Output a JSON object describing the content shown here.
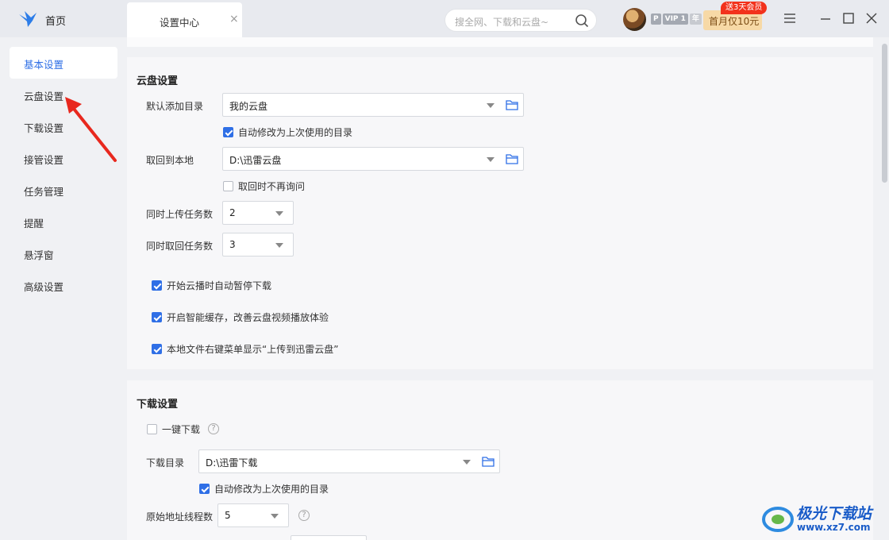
{
  "titlebar": {
    "home_label": "首页",
    "tab_label": "设置中心",
    "tab_close": "×",
    "search_placeholder": "搜全网、下载和云盘~",
    "badge_p": "P",
    "badge_vip": "VIP 1",
    "badge_year": "年",
    "promo_label": "首月仅10元",
    "promo_tag": "送3天会员"
  },
  "sidebar": {
    "items": [
      {
        "label": "基本设置"
      },
      {
        "label": "云盘设置"
      },
      {
        "label": "下载设置"
      },
      {
        "label": "接管设置"
      },
      {
        "label": "任务管理"
      },
      {
        "label": "提醒"
      },
      {
        "label": "悬浮窗"
      },
      {
        "label": "高级设置"
      }
    ],
    "active": "基本设置"
  },
  "cloud": {
    "title": "云盘设置",
    "default_dir_label": "默认添加目录",
    "default_dir_value": "我的云盘",
    "auto_change_1": "自动修改为上次使用的目录",
    "auto_change_1_checked": true,
    "fetch_local_label": "取回到本地",
    "fetch_local_value": "D:\\迅雷云盘",
    "no_ask": "取回时不再询问",
    "no_ask_checked": false,
    "upload_tasks_label": "同时上传任务数",
    "upload_tasks_value": "2",
    "fetch_tasks_label": "同时取回任务数",
    "fetch_tasks_value": "3",
    "opt_pause": "开始云播时自动暂停下载",
    "opt_cache": "开启智能缓存，改善云盘视频播放体验",
    "opt_menu": "本地文件右键菜单显示“上传到迅雷云盘”"
  },
  "download": {
    "title": "下载设置",
    "one_click": "一键下载",
    "one_click_checked": false,
    "dir_label": "下载目录",
    "dir_value": "D:\\迅雷下载",
    "auto_change": "自动修改为上次使用的目录",
    "auto_change_checked": true,
    "threads_label": "原始地址线程数",
    "threads_value": "5",
    "help": "?"
  },
  "watermark": {
    "brand": "极光下载站",
    "url": "www.xz7.com"
  },
  "colors": {
    "accent": "#2f6fe6",
    "annotation_arrow": "#e8281e",
    "promo_bg": "#f7d9a6",
    "promo_tag": "#f2321c"
  }
}
